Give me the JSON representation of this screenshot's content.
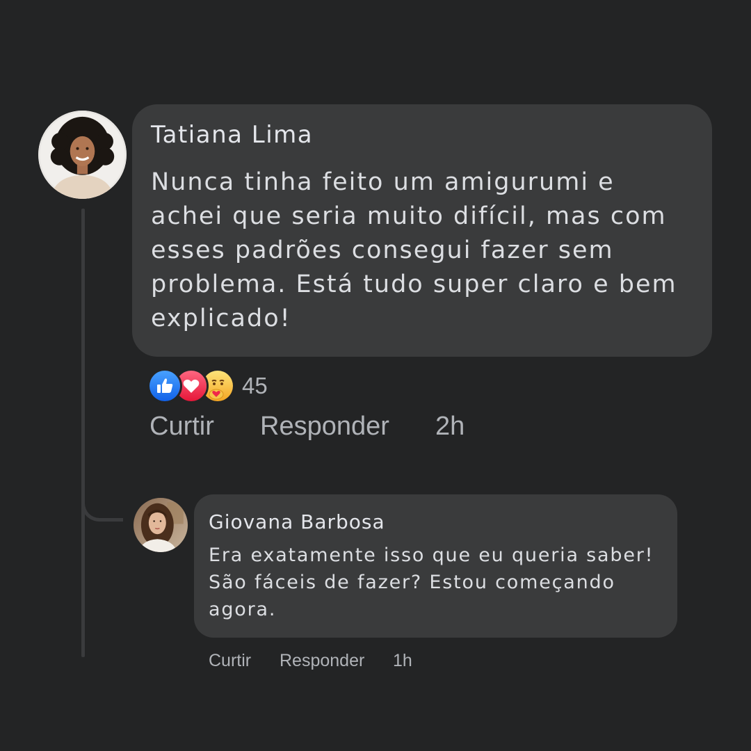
{
  "comment": {
    "author": "Tatiana Lima",
    "text": "Nunca tinha feito um amigurumi e achei que seria muito difícil, mas com esses padrões consegui fazer sem problema. Está tudo super claro e bem explicado!",
    "reactions": {
      "icons": [
        "like-icon",
        "love-icon",
        "care-icon"
      ],
      "count": "45"
    },
    "actions": {
      "like_label": "Curtir",
      "reply_label": "Responder",
      "time": "2h"
    }
  },
  "reply": {
    "author": "Giovana Barbosa",
    "text": "Era exatamente isso que eu queria saber! São fáceis de fazer? Estou começando agora.",
    "actions": {
      "like_label": "Curtir",
      "reply_label": "Responder",
      "time": "1h"
    }
  },
  "colors": {
    "background": "#232425",
    "bubble": "#3a3b3c",
    "text_primary": "#e4e6eb",
    "text_secondary": "#b0b3b8",
    "like_blue": "#1877f2",
    "love_red": "#f02849",
    "care_yellow": "#f7b928"
  }
}
